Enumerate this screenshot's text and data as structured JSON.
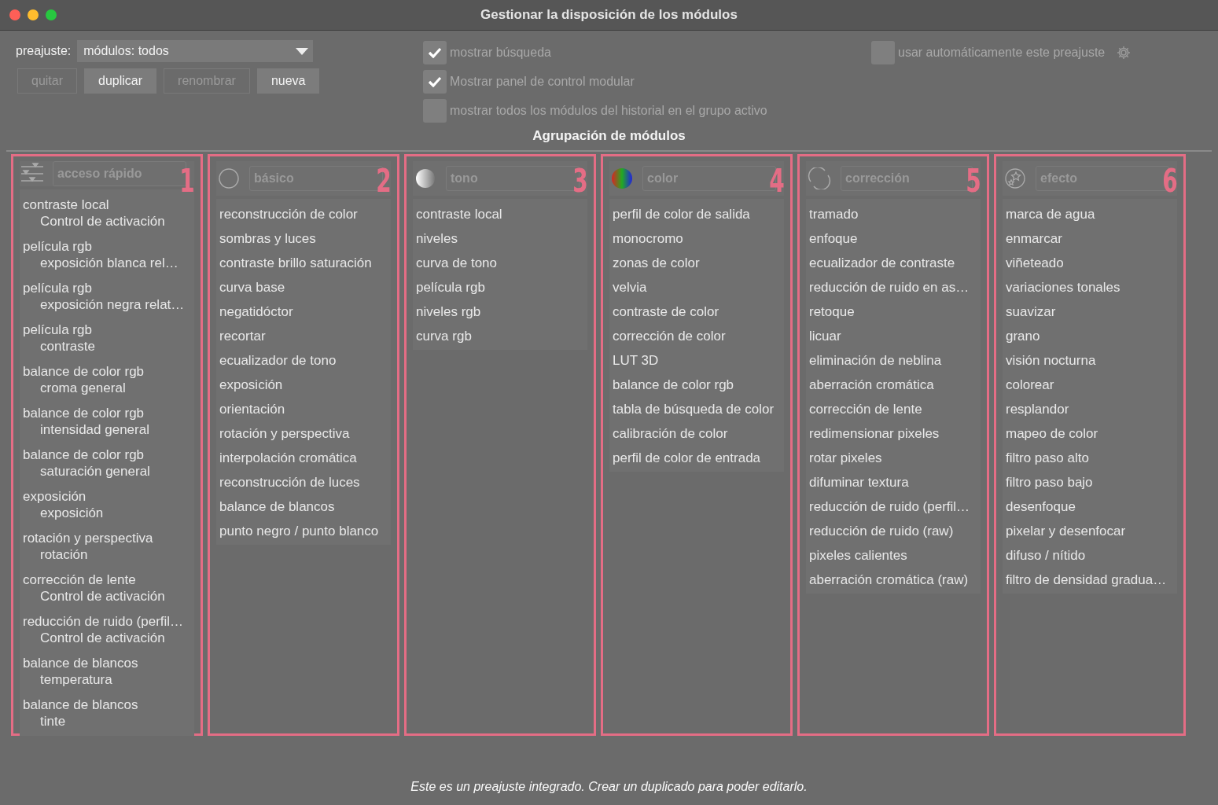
{
  "window": {
    "title": "Gestionar la disposición de los módulos"
  },
  "preset": {
    "label": "preajuste:",
    "value": "módulos: todos"
  },
  "buttons": [
    {
      "label": "quitar",
      "disabled": true
    },
    {
      "label": "duplicar",
      "disabled": false
    },
    {
      "label": "renombrar",
      "disabled": true
    },
    {
      "label": "nueva",
      "disabled": false
    }
  ],
  "options": [
    {
      "label": "mostrar búsqueda",
      "checked": true
    },
    {
      "label": "Mostrar panel de control modular",
      "checked": true
    },
    {
      "label": "mostrar todos los módulos del historial en el grupo activo",
      "checked": false
    }
  ],
  "auto_preset": {
    "label": "usar automáticamente este preajuste",
    "checked": false
  },
  "section_title": "Agrupación de módulos",
  "groups": [
    {
      "kind": "sliders",
      "name": "acceso rápido",
      "number": "1",
      "modules": [
        {
          "name": "contraste local",
          "detail": "Control de activación"
        },
        {
          "name": "película rgb",
          "detail": "exposición blanca rel…"
        },
        {
          "name": "película rgb",
          "detail": "exposición negra relat…"
        },
        {
          "name": "película rgb",
          "detail": "contraste"
        },
        {
          "name": "balance de color rgb",
          "detail": "croma general"
        },
        {
          "name": "balance de color rgb",
          "detail": "intensidad general"
        },
        {
          "name": "balance de color rgb",
          "detail": "saturación general"
        },
        {
          "name": "exposición",
          "detail": "exposición"
        },
        {
          "name": "rotación y perspectiva",
          "detail": "rotación"
        },
        {
          "name": "corrección de lente",
          "detail": "Control de activación"
        },
        {
          "name": "reducción de ruido (perfil…",
          "detail": "Control de activación"
        },
        {
          "name": "balance de blancos",
          "detail": "temperatura"
        },
        {
          "name": "balance de blancos",
          "detail": "tinte"
        }
      ]
    },
    {
      "kind": "circle",
      "name": "básico",
      "number": "2",
      "modules": [
        {
          "name": "reconstrucción de color"
        },
        {
          "name": "sombras y luces"
        },
        {
          "name": "contraste brillo saturación"
        },
        {
          "name": "curva base"
        },
        {
          "name": "negatidóctor"
        },
        {
          "name": "recortar"
        },
        {
          "name": "ecualizador de tono"
        },
        {
          "name": "exposición"
        },
        {
          "name": "orientación"
        },
        {
          "name": "rotación y perspectiva"
        },
        {
          "name": "interpolación cromática"
        },
        {
          "name": "reconstrucción de luces"
        },
        {
          "name": "balance de blancos"
        },
        {
          "name": "punto negro / punto blanco"
        }
      ]
    },
    {
      "kind": "sphere",
      "name": "tono",
      "number": "3",
      "modules": [
        {
          "name": "contraste local"
        },
        {
          "name": "niveles"
        },
        {
          "name": "curva de tono"
        },
        {
          "name": "película rgb"
        },
        {
          "name": "niveles rgb"
        },
        {
          "name": "curva rgb"
        }
      ]
    },
    {
      "kind": "spectrum",
      "name": "color",
      "number": "4",
      "modules": [
        {
          "name": "perfil de color de salida"
        },
        {
          "name": "monocromo"
        },
        {
          "name": "zonas de color"
        },
        {
          "name": "velvia"
        },
        {
          "name": "contraste de color"
        },
        {
          "name": "corrección de color"
        },
        {
          "name": "LUT 3D"
        },
        {
          "name": "balance de color rgb"
        },
        {
          "name": "tabla de búsqueda de color"
        },
        {
          "name": "calibración de color"
        },
        {
          "name": "perfil de color de entrada"
        }
      ]
    },
    {
      "kind": "arcs",
      "name": "corrección",
      "number": "5",
      "modules": [
        {
          "name": "tramado"
        },
        {
          "name": "enfoque"
        },
        {
          "name": "ecualizador de contraste"
        },
        {
          "name": "reducción de ruido en as…"
        },
        {
          "name": "retoque"
        },
        {
          "name": "licuar"
        },
        {
          "name": "eliminación de neblina"
        },
        {
          "name": "aberración cromática"
        },
        {
          "name": "corrección de lente"
        },
        {
          "name": "redimensionar pixeles"
        },
        {
          "name": "rotar pixeles"
        },
        {
          "name": "difuminar textura"
        },
        {
          "name": "reducción de ruido (perfil…"
        },
        {
          "name": "reducción de ruido (raw)"
        },
        {
          "name": "pixeles calientes"
        },
        {
          "name": "aberración cromática (raw)"
        }
      ]
    },
    {
      "kind": "stars",
      "name": "efecto",
      "number": "6",
      "modules": [
        {
          "name": "marca de agua"
        },
        {
          "name": "enmarcar"
        },
        {
          "name": "viñeteado"
        },
        {
          "name": "variaciones tonales"
        },
        {
          "name": "suavizar"
        },
        {
          "name": "grano"
        },
        {
          "name": "visión nocturna"
        },
        {
          "name": "colorear"
        },
        {
          "name": "resplandor"
        },
        {
          "name": "mapeo de color"
        },
        {
          "name": "filtro paso alto"
        },
        {
          "name": "filtro paso bajo"
        },
        {
          "name": "desenfoque"
        },
        {
          "name": "pixelar y desenfocar"
        },
        {
          "name": "difuso / nítido"
        },
        {
          "name": "filtro de densidad gradua…"
        }
      ]
    }
  ],
  "footer": "Este es un preajuste integrado. Crear un duplicado para poder editarlo."
}
